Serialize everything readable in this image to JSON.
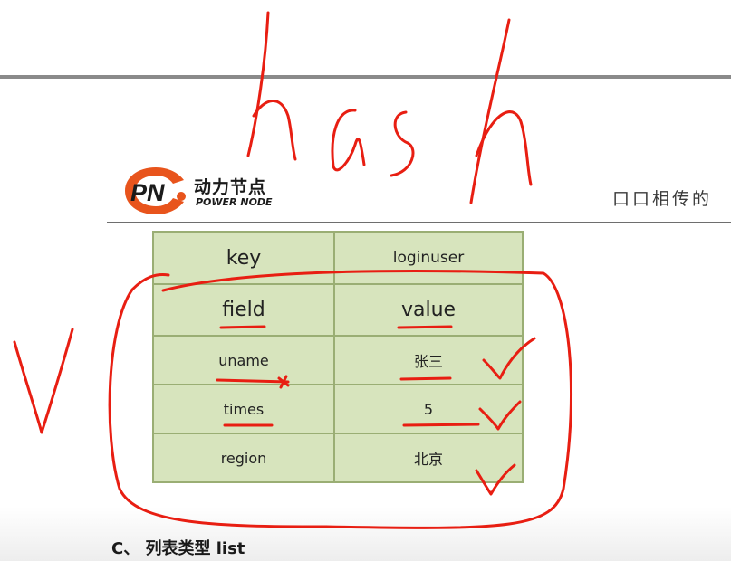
{
  "header": {
    "logo": {
      "mark_text": "PN",
      "cn_text": "动力节点",
      "en_text": "POWER NODE",
      "brand_color": "#e8541c"
    },
    "right_text": "口口相传的"
  },
  "hash_table": {
    "key_row": {
      "label": "key",
      "value": "loginuser"
    },
    "header_row": {
      "field": "field",
      "value": "value"
    },
    "rows": [
      {
        "field": "uname",
        "value": "张三"
      },
      {
        "field": "times",
        "value": "5"
      },
      {
        "field": "region",
        "value": "北京"
      }
    ],
    "cell_color": "#d7e4bd",
    "border_color": "#9aae74"
  },
  "section": {
    "heading": "C、 列表类型  list"
  },
  "annotation": {
    "handwritten_text": "hash",
    "ink_color": "#e81e12"
  }
}
